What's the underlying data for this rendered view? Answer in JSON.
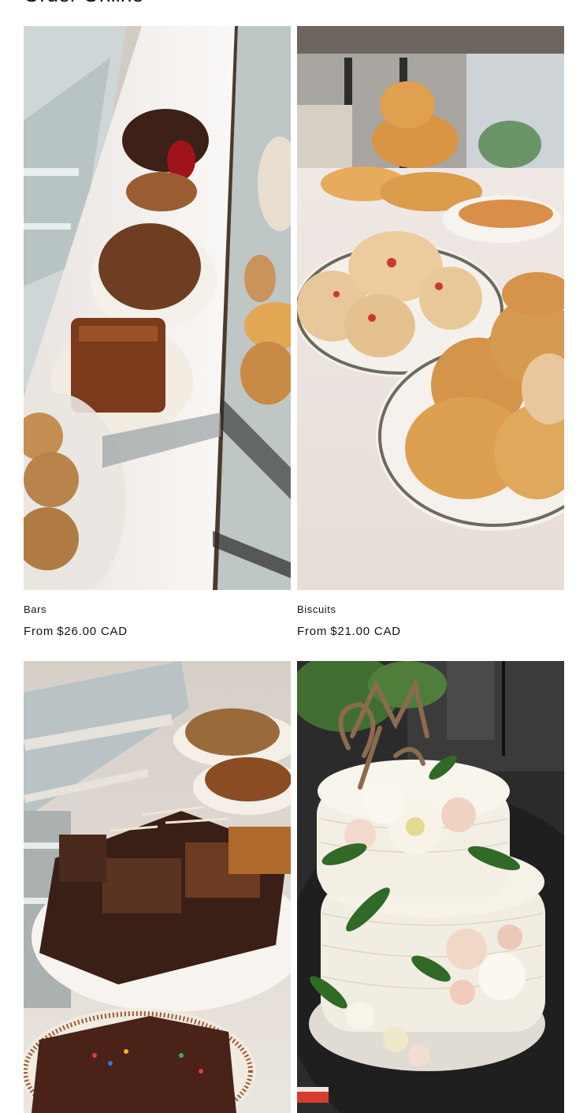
{
  "section": {
    "title": "Order Online"
  },
  "products": [
    {
      "title": "Bars",
      "price_prefix": "From",
      "price": "$26.00 CAD",
      "image": "bars-display-photo"
    },
    {
      "title": "Biscuits",
      "price_prefix": "From",
      "price": "$21.00 CAD",
      "image": "biscuits-scones-photo"
    },
    {
      "title": "",
      "price_prefix": "",
      "price": "",
      "image": "brownies-platter-photo"
    },
    {
      "title": "",
      "price_prefix": "",
      "price": "",
      "image": "wedding-cake-photo"
    }
  ]
}
